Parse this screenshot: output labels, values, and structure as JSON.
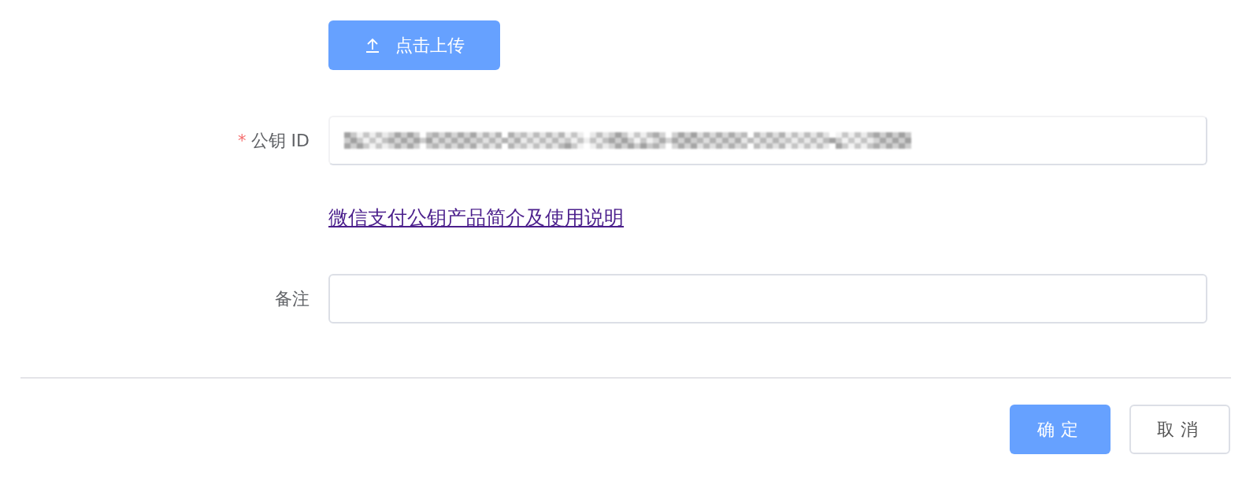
{
  "upload_button": {
    "label": "点击上传"
  },
  "fields": [
    {
      "label": "公钥 ID",
      "required_mark": "*",
      "redacted": true
    },
    {
      "label": "备注"
    }
  ],
  "help_link": {
    "text": "微信支付公钥产品简介及使用说明"
  },
  "buttons": [
    {
      "label": "确定",
      "kind": "primary"
    },
    {
      "label": "取消",
      "kind": "default"
    }
  ]
}
